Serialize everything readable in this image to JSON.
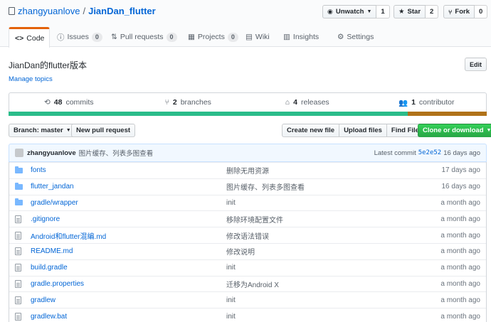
{
  "repo": {
    "owner": "zhangyuanlove",
    "separator": "/",
    "name": "JianDan_flutter",
    "description": "JianDan的flutter版本",
    "manage_topics": "Manage topics",
    "edit_label": "Edit"
  },
  "actions": {
    "watch_label": "Unwatch",
    "watch_count": "1",
    "star_label": "Star",
    "star_count": "2",
    "fork_label": "Fork",
    "fork_count": "0"
  },
  "tabs": [
    {
      "label": "Code",
      "icon": "code-icon"
    },
    {
      "label": "Issues",
      "count": "0",
      "icon": "issue-icon"
    },
    {
      "label": "Pull requests",
      "count": "0",
      "icon": "pull-request-icon"
    },
    {
      "label": "Projects",
      "count": "0",
      "icon": "project-icon"
    },
    {
      "label": "Wiki",
      "icon": "book-icon"
    },
    {
      "label": "Insights",
      "icon": "graph-icon"
    },
    {
      "label": "Settings",
      "icon": "gear-icon"
    }
  ],
  "stats": {
    "commits_num": "48",
    "commits_label": "commits",
    "branches_num": "2",
    "branches_label": "branches",
    "releases_num": "4",
    "releases_label": "releases",
    "contributors_num": "1",
    "contributors_label": "contributor"
  },
  "languages": {
    "primary_color": "#2bbc8a",
    "secondary_color": "#b07219"
  },
  "toolbar": {
    "branch_label": "Branch: master",
    "new_pr_label": "New pull request",
    "create_file_label": "Create new file",
    "upload_label": "Upload files",
    "find_label": "Find File",
    "clone_label": "Clone or download"
  },
  "latest_commit": {
    "author": "zhangyuanlove",
    "message": "图片缓存、列表多图查看",
    "prefix": "Latest commit",
    "sha": "5e2e52",
    "age": "16 days ago"
  },
  "files": [
    {
      "type": "dir",
      "name": "fonts",
      "message": "删除无用资源",
      "age": "17 days ago"
    },
    {
      "type": "dir",
      "name": "flutter_jandan",
      "message": "图片缓存、列表多图查看",
      "age": "16 days ago"
    },
    {
      "type": "dir",
      "name": "gradle/wrapper",
      "message": "init",
      "age": "a month ago"
    },
    {
      "type": "file",
      "name": ".gitignore",
      "message": "移除环境配置文件",
      "age": "a month ago"
    },
    {
      "type": "file",
      "name": "Android和flutter混编.md",
      "message": "修改语法错误",
      "age": "a month ago"
    },
    {
      "type": "file",
      "name": "README.md",
      "message": "修改说明",
      "age": "a month ago"
    },
    {
      "type": "file",
      "name": "build.gradle",
      "message": "init",
      "age": "a month ago"
    },
    {
      "type": "file",
      "name": "gradle.properties",
      "message": "迁移为Android X",
      "age": "a month ago"
    },
    {
      "type": "file",
      "name": "gradlew",
      "message": "init",
      "age": "a month ago"
    },
    {
      "type": "file",
      "name": "gradlew.bat",
      "message": "init",
      "age": "a month ago"
    }
  ]
}
